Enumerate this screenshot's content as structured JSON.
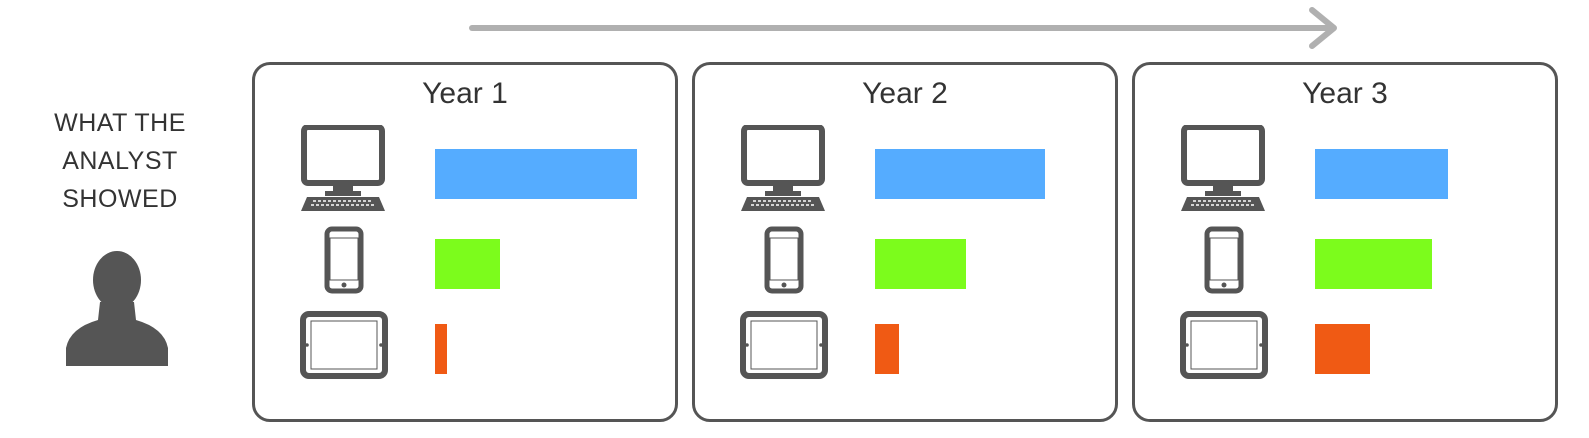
{
  "analyst": {
    "label": "WHAT THE\nANALYST\nSHOWED"
  },
  "devices": [
    {
      "id": "desktop",
      "icon": "desktop-computer-icon",
      "color": "#55acff"
    },
    {
      "id": "mobile",
      "icon": "smartphone-icon",
      "color": "#7cfc1c"
    },
    {
      "id": "tablet",
      "icon": "tablet-icon",
      "color": "#f05a14"
    }
  ],
  "chart_data": {
    "type": "bar",
    "orientation": "horizontal",
    "scale_note": "relative bar lengths per year; no axis printed",
    "panels": [
      {
        "title": "Year 1",
        "values": {
          "desktop": 100,
          "mobile": 32,
          "tablet": 6
        }
      },
      {
        "title": "Year 2",
        "values": {
          "desktop": 84,
          "mobile": 45,
          "tablet": 12
        }
      },
      {
        "title": "Year 3",
        "values": {
          "desktop": 66,
          "mobile": 58,
          "tablet": 27
        }
      }
    ]
  }
}
